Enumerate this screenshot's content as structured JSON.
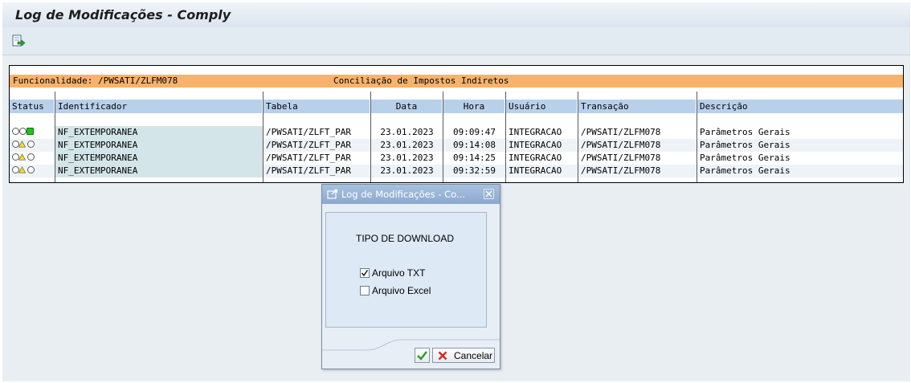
{
  "window": {
    "title": "Log de Modificações - Comply"
  },
  "toolbar": {
    "export_icon": "export-icon"
  },
  "header": {
    "funcionalidade": "Funcionalidade: /PWSATI/ZLFM078",
    "report_title": "Conciliação de Impostos Indiretos"
  },
  "columns": [
    "Status",
    "Identificador",
    "Tabela",
    "Data",
    "Hora",
    "Usuário",
    "Transação",
    "Descrição"
  ],
  "rows": [
    {
      "status": [
        "off",
        "off",
        "green"
      ],
      "identificador": "NF_EXTEMPORANEA",
      "tabela": "/PWSATI/ZLFT_PAR",
      "data": "23.01.2023",
      "hora": "09:09:47",
      "usuario": "INTEGRACAO",
      "transacao": "/PWSATI/ZLFM078",
      "descricao": "Parâmetros Gerais"
    },
    {
      "status": [
        "off",
        "yellow",
        "off"
      ],
      "identificador": "NF_EXTEMPORANEA",
      "tabela": "/PWSATI/ZLFT_PAR",
      "data": "23.01.2023",
      "hora": "09:14:08",
      "usuario": "INTEGRACAO",
      "transacao": "/PWSATI/ZLFM078",
      "descricao": "Parâmetros Gerais"
    },
    {
      "status": [
        "off",
        "yellow",
        "off"
      ],
      "identificador": "NF_EXTEMPORANEA",
      "tabela": "/PWSATI/ZLFT_PAR",
      "data": "23.01.2023",
      "hora": "09:14:25",
      "usuario": "INTEGRACAO",
      "transacao": "/PWSATI/ZLFM078",
      "descricao": "Parâmetros Gerais"
    },
    {
      "status": [
        "off",
        "yellow",
        "off"
      ],
      "identificador": "NF_EXTEMPORANEA",
      "tabela": "/PWSATI/ZLFT_PAR",
      "data": "23.01.2023",
      "hora": "09:32:59",
      "usuario": "INTEGRACAO",
      "transacao": "/PWSATI/ZLFM078",
      "descricao": "Parâmetros Gerais"
    }
  ],
  "dialog": {
    "title": "Log de Modificações - Co...",
    "section_label": "TIPO DE DOWNLOAD",
    "options": [
      {
        "label": "Arquivo TXT",
        "checked": true
      },
      {
        "label": "Arquivo Excel",
        "checked": false
      }
    ],
    "cancel_label": "Cancelar"
  },
  "colors": {
    "header_bar": "#f9b26a",
    "column_header": "#b8d1ea",
    "ident_cell": "#d3e5e8",
    "light_green": "#1fc21f",
    "light_yellow": "#f2e01c",
    "dialog_title": "#8aa8cf"
  }
}
